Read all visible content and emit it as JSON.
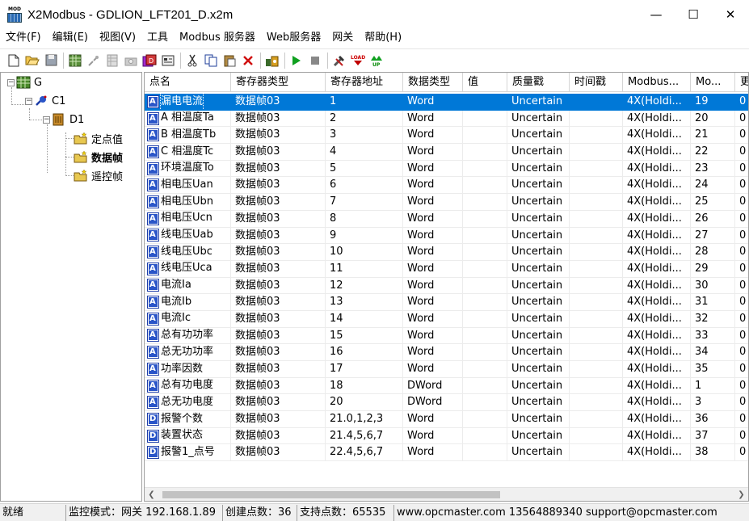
{
  "window": {
    "title": "X2Modbus - GDLION_LFT201_D.x2m",
    "icon_text": "MOD",
    "minimize": "—",
    "maximize": "☐",
    "close": "✕"
  },
  "menu": [
    "文件(F)",
    "编辑(E)",
    "视图(V)",
    "工具",
    "Modbus 服务器",
    "Web服务器",
    "网关",
    "帮助(H)"
  ],
  "toolbar": [
    "new-icon",
    "open-icon",
    "save-icon",
    "sep",
    "grid-icon",
    "connect-icon",
    "table-icon",
    "camera-icon",
    "points-icon",
    "properties-icon",
    "sep",
    "cut-icon",
    "copy-icon",
    "paste-icon",
    "delete-icon",
    "sep",
    "scan-icon",
    "sep",
    "run-icon",
    "stop-icon",
    "sep",
    "tools-icon",
    "load-icon",
    "up-icon"
  ],
  "tree": {
    "root": "G",
    "channel": "C1",
    "device": "D1",
    "groups": [
      "定点值",
      "数据帧",
      "遥控帧"
    ]
  },
  "table": {
    "headers": [
      "点名",
      "寄存器类型",
      "寄存器地址",
      "数据类型",
      "值",
      "质量戳",
      "时间戳",
      "Modbus...",
      "Mo...",
      "更"
    ],
    "rows": [
      [
        "漏电电流",
        "数据帧03",
        "1",
        "Word",
        "",
        "Uncertain",
        "",
        "4X(Holdi...",
        "19",
        "0"
      ],
      [
        "A 相温度Ta",
        "数据帧03",
        "2",
        "Word",
        "",
        "Uncertain",
        "",
        "4X(Holdi...",
        "20",
        "0"
      ],
      [
        "B 相温度Tb",
        "数据帧03",
        "3",
        "Word",
        "",
        "Uncertain",
        "",
        "4X(Holdi...",
        "21",
        "0"
      ],
      [
        "C 相温度Tc",
        "数据帧03",
        "4",
        "Word",
        "",
        "Uncertain",
        "",
        "4X(Holdi...",
        "22",
        "0"
      ],
      [
        "环境温度To",
        "数据帧03",
        "5",
        "Word",
        "",
        "Uncertain",
        "",
        "4X(Holdi...",
        "23",
        "0"
      ],
      [
        "相电压Uan",
        "数据帧03",
        "6",
        "Word",
        "",
        "Uncertain",
        "",
        "4X(Holdi...",
        "24",
        "0"
      ],
      [
        "相电压Ubn",
        "数据帧03",
        "7",
        "Word",
        "",
        "Uncertain",
        "",
        "4X(Holdi...",
        "25",
        "0"
      ],
      [
        "相电压Ucn",
        "数据帧03",
        "8",
        "Word",
        "",
        "Uncertain",
        "",
        "4X(Holdi...",
        "26",
        "0"
      ],
      [
        "线电压Uab",
        "数据帧03",
        "9",
        "Word",
        "",
        "Uncertain",
        "",
        "4X(Holdi...",
        "27",
        "0"
      ],
      [
        "线电压Ubc",
        "数据帧03",
        "10",
        "Word",
        "",
        "Uncertain",
        "",
        "4X(Holdi...",
        "28",
        "0"
      ],
      [
        "线电压Uca",
        "数据帧03",
        "11",
        "Word",
        "",
        "Uncertain",
        "",
        "4X(Holdi...",
        "29",
        "0"
      ],
      [
        "电流Ia",
        "数据帧03",
        "12",
        "Word",
        "",
        "Uncertain",
        "",
        "4X(Holdi...",
        "30",
        "0"
      ],
      [
        "电流Ib",
        "数据帧03",
        "13",
        "Word",
        "",
        "Uncertain",
        "",
        "4X(Holdi...",
        "31",
        "0"
      ],
      [
        "电流Ic",
        "数据帧03",
        "14",
        "Word",
        "",
        "Uncertain",
        "",
        "4X(Holdi...",
        "32",
        "0"
      ],
      [
        "总有功功率",
        "数据帧03",
        "15",
        "Word",
        "",
        "Uncertain",
        "",
        "4X(Holdi...",
        "33",
        "0"
      ],
      [
        "总无功功率",
        "数据帧03",
        "16",
        "Word",
        "",
        "Uncertain",
        "",
        "4X(Holdi...",
        "34",
        "0"
      ],
      [
        "功率因数",
        "数据帧03",
        "17",
        "Word",
        "",
        "Uncertain",
        "",
        "4X(Holdi...",
        "35",
        "0"
      ],
      [
        "总有功电度",
        "数据帧03",
        "18",
        "DWord",
        "",
        "Uncertain",
        "",
        "4X(Holdi...",
        "1",
        "0"
      ],
      [
        "总无功电度",
        "数据帧03",
        "20",
        "DWord",
        "",
        "Uncertain",
        "",
        "4X(Holdi...",
        "3",
        "0"
      ],
      [
        "报警个数",
        "数据帧03",
        "21.0,1,2,3",
        "Word",
        "",
        "Uncertain",
        "",
        "4X(Holdi...",
        "36",
        "0"
      ],
      [
        "装置状态",
        "数据帧03",
        "21.4,5,6,7",
        "Word",
        "",
        "Uncertain",
        "",
        "4X(Holdi...",
        "37",
        "0"
      ],
      [
        "报警1_点号",
        "数据帧03",
        "22.4,5,6,7",
        "Word",
        "",
        "Uncertain",
        "",
        "4X(Holdi...",
        "38",
        "0"
      ]
    ],
    "row_icons": [
      "A",
      "A",
      "A",
      "A",
      "A",
      "A",
      "A",
      "A",
      "A",
      "A",
      "A",
      "A",
      "A",
      "A",
      "A",
      "A",
      "A",
      "A",
      "A",
      "D",
      "D",
      "D"
    ]
  },
  "status": {
    "ready": "就绪",
    "monitor": "监控模式：网关 192.168.1.89",
    "created": "创建点数：36",
    "supported": "支持点数：65535",
    "contact": "www.opcmaster.com 13564889340 support@opcmaster.com"
  },
  "colors": {
    "selection": "#0078d7",
    "point_icon": "#2a55c8"
  }
}
